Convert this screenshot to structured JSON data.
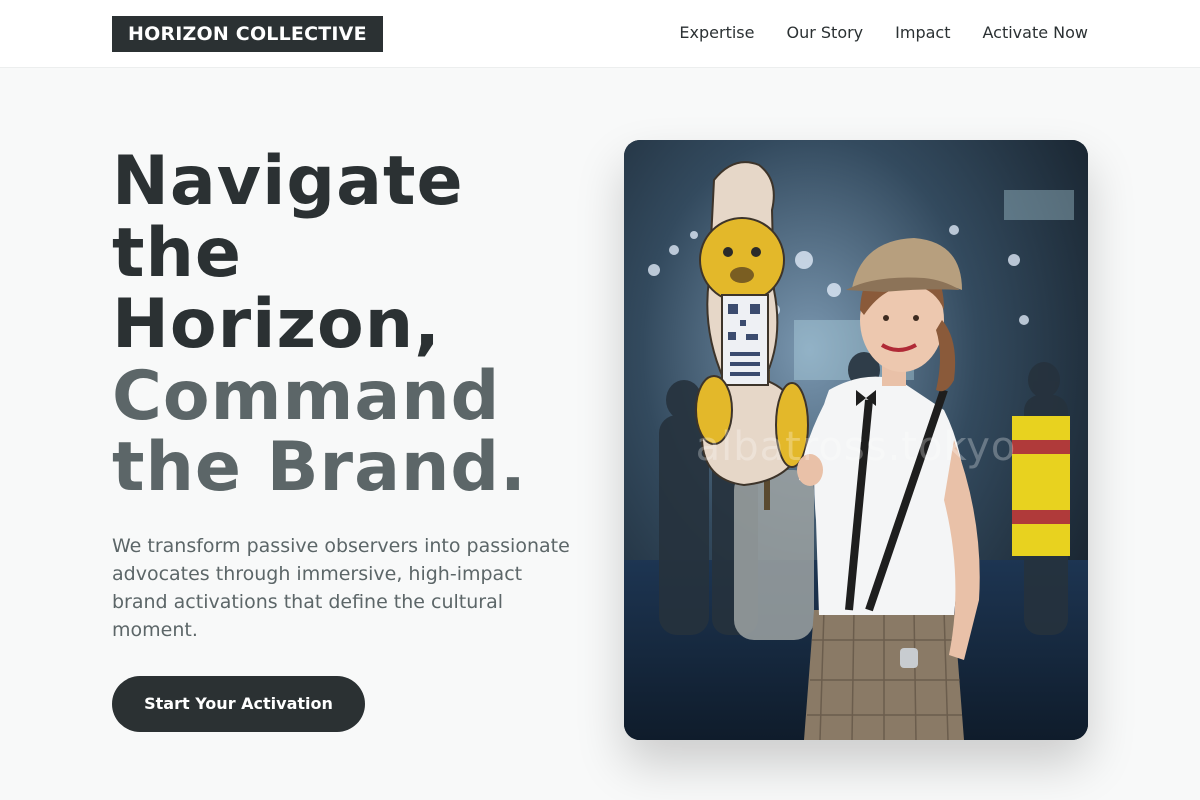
{
  "header": {
    "logo": "HORIZON COLLECTIVE",
    "nav": [
      {
        "label": "Expertise"
      },
      {
        "label": "Our Story"
      },
      {
        "label": "Impact"
      },
      {
        "label": "Activate Now"
      }
    ]
  },
  "hero": {
    "headline_lines": [
      "Navigate",
      "the",
      "Horizon,",
      "Command",
      "the Brand."
    ],
    "subtext": "We transform passive observers into passionate advocates through immersive, high-impact brand activations that define the cultural moment.",
    "cta_label": "Start Your Activation",
    "image": {
      "watermark": "albatross.tokyo",
      "description_icon": "photo-promo-model-with-lion-sign"
    }
  },
  "colors": {
    "primary": "#2b3133",
    "muted": "#5c6668",
    "background": "#f8f9f9",
    "header_bg": "#ffffff"
  }
}
